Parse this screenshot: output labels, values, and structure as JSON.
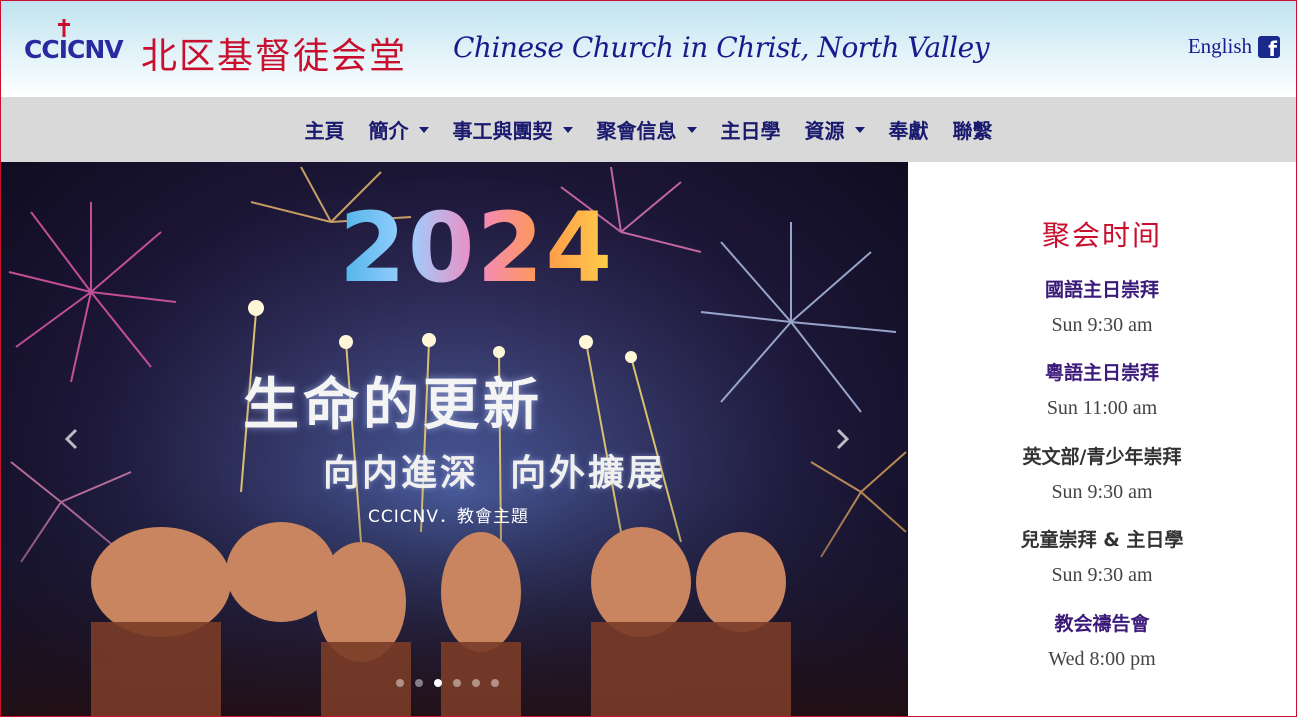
{
  "header": {
    "logo_text": "CCICNV",
    "title_cn": "北区基督徒会堂",
    "title_en": "Chinese Church in Christ, North Valley",
    "language_link": "English",
    "facebook_icon": "facebook-icon"
  },
  "nav": {
    "items": [
      {
        "label": "主頁",
        "dropdown": false
      },
      {
        "label": "簡介",
        "dropdown": true
      },
      {
        "label": "事工與團契",
        "dropdown": true
      },
      {
        "label": "聚會信息",
        "dropdown": true
      },
      {
        "label": "主日學",
        "dropdown": false
      },
      {
        "label": "資源",
        "dropdown": true
      },
      {
        "label": "奉獻",
        "dropdown": false
      },
      {
        "label": "聯繫",
        "dropdown": false
      }
    ]
  },
  "carousel": {
    "slide_year": "2024",
    "slide_title": "生命的更新",
    "slide_subtitle": "向内進深  向外擴展",
    "slide_caption": "CCICNV．教會主題",
    "indicator_count": 6,
    "active_index": 2,
    "prev_icon": "chevron-left-icon",
    "next_icon": "chevron-right-icon"
  },
  "sidebar": {
    "heading": "聚会时间",
    "services": [
      {
        "name": "國語主日崇拜",
        "time": "Sun 9:30 am",
        "color": "#3b1a7a"
      },
      {
        "name": "粵語主日崇拜",
        "time": "Sun 11:00 am",
        "color": "#3b1a7a"
      },
      {
        "name": "英文部/青少年崇拜",
        "time": "Sun 9:30 am",
        "color": "#333333"
      },
      {
        "name": "兒童崇拜 & 主日學",
        "time": "Sun 9:30 am",
        "color": "#333333"
      },
      {
        "name": "教会禱告會",
        "time": "Wed 8:00 pm",
        "color": "#3b1a7a"
      }
    ]
  },
  "colors": {
    "brand_red": "#c8102e",
    "brand_navy": "#1a1a8c",
    "nav_bg": "#d9d9d9"
  }
}
